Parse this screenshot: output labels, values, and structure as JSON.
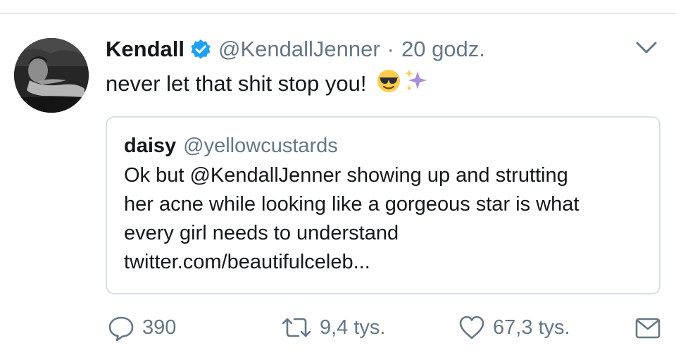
{
  "tweet": {
    "display_name": "Kendall",
    "handle": "@KendallJenner",
    "separator": "·",
    "time": "20 godz.",
    "text": "never let that shit stop you!",
    "emojis": [
      "smiling-face-with-sunglasses",
      "sparkles"
    ]
  },
  "quote": {
    "display_name": "daisy",
    "handle": "@yellowcustards",
    "lines": [
      "Ok but @KendallJenner showing up and strutting",
      "her acne while looking like a gorgeous star is what",
      "every girl needs to understand",
      "twitter.com/beautifulceleb..."
    ]
  },
  "actions": {
    "replies": "390",
    "retweets": "9,4 tys.",
    "likes": "67,3 tys."
  },
  "colors": {
    "text": "#14171a",
    "secondary": "#657786",
    "verified": "#1da1f2",
    "border": "#d8e0e6"
  },
  "icons": [
    "verified-badge-icon",
    "chevron-down-icon",
    "reply-icon",
    "retweet-icon",
    "like-icon",
    "direct-message-icon"
  ]
}
